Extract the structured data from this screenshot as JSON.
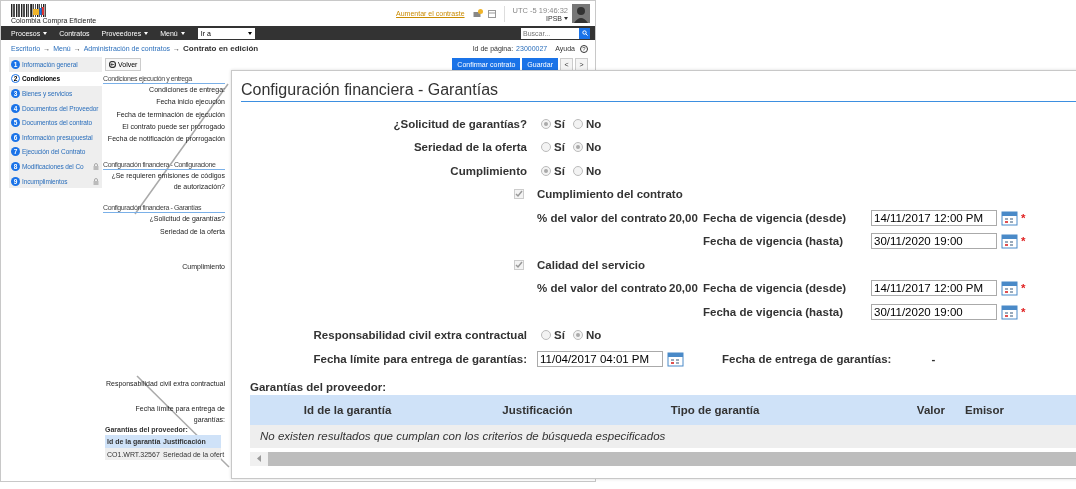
{
  "background_page": {
    "logo_text": "Colombia Compra Eficiente",
    "contrast_link": "Aumentar el contraste",
    "clock": "UTC -5 19:46:32",
    "user": "IPSB",
    "nav": [
      {
        "label": "Procesos",
        "menu": true
      },
      {
        "label": "Contratos",
        "menu": false
      },
      {
        "label": "Proveedores",
        "menu": true
      },
      {
        "label": "Menú",
        "menu": true
      }
    ],
    "goto_select": "Ir a",
    "search_placeholder": "Buscar...",
    "breadcrumb": [
      {
        "kind": "link",
        "label": "Escritorio"
      },
      {
        "kind": "separator",
        "label": "→"
      },
      {
        "kind": "link",
        "label": "Menú"
      },
      {
        "kind": "separator",
        "label": "→"
      },
      {
        "kind": "link",
        "label": "Administración de contratos"
      },
      {
        "kind": "separator",
        "label": "→"
      },
      {
        "kind": "current",
        "label": "Contrato en edición"
      }
    ],
    "page_id_label": "Id de página:",
    "page_id": "23000027",
    "help": "Ayuda",
    "help_icon": "?",
    "back_button": "Volver",
    "actions": [
      {
        "label": "Confirmar contrato",
        "kind": "primary"
      },
      {
        "label": "Guardar",
        "kind": "primary"
      },
      {
        "label": "<",
        "kind": "pager"
      },
      {
        "label": ">",
        "kind": "pager"
      }
    ],
    "steps": [
      {
        "number": "1",
        "label": "Información general",
        "selected": false,
        "locked": false
      },
      {
        "number": "2",
        "label": "Condiciones",
        "selected": true,
        "locked": false
      },
      {
        "number": "3",
        "label": "Bienes y servicios",
        "selected": false,
        "locked": false
      },
      {
        "number": "4",
        "label": "Documentos del Proveedor",
        "selected": false,
        "locked": false
      },
      {
        "number": "5",
        "label": "Documentos del contrato",
        "selected": false,
        "locked": false
      },
      {
        "number": "6",
        "label": "Información presupuestal",
        "selected": false,
        "locked": false
      },
      {
        "number": "7",
        "label": "Ejecución del Contrato",
        "selected": false,
        "locked": false
      },
      {
        "number": "8",
        "label": "Modificaciones del Co",
        "selected": false,
        "locked": true
      },
      {
        "number": "9",
        "label": "Incumplimientos",
        "selected": false,
        "locked": true
      }
    ],
    "sections": [
      {
        "title": "Condiciones ejecución y entrega",
        "rows": [
          "Condiciones de entrega:",
          "Fecha inicio ejecución",
          "Fecha de terminación de ejecución",
          "El contrato puede ser prorrogado",
          "Fecha de notificación de prorrogación"
        ]
      },
      {
        "title": "Configuración financiera - Configuracione",
        "rows": [
          "¿Se requieren emisiones de códigos de autorización?"
        ]
      },
      {
        "title": "Configuración financiera - Garantías",
        "rows": [
          "¿Solicitud de garantías?",
          "Seriedad de la oferta",
          "Cumplimiento",
          "Responsabilidad civil extra contractual",
          "Fecha límite para entrega de garantías:"
        ]
      }
    ],
    "guarantees_title": "Garantías del proveedor:",
    "guarantees_columns": [
      "Id de la garantía",
      "Justificación"
    ],
    "guarantees_rows": [
      [
        "CO1.WRT.32567",
        "Seriedad de la ofert"
      ]
    ]
  },
  "panel": {
    "title": "Configuración financiera - Garantías",
    "rows": [
      {
        "kind": "choice",
        "label": "¿Solicitud de garantías?",
        "options": [
          {
            "label": "Sí",
            "selected": true
          },
          {
            "label": "No",
            "selected": false
          }
        ]
      },
      {
        "kind": "choice",
        "label": "Seriedad de la oferta",
        "options": [
          {
            "label": "Sí",
            "selected": false
          },
          {
            "label": "No",
            "selected": true
          }
        ]
      },
      {
        "kind": "choice",
        "label": "Cumplimiento",
        "options": [
          {
            "label": "Sí",
            "selected": true
          },
          {
            "label": "No",
            "selected": false
          }
        ]
      },
      {
        "kind": "coverage",
        "label": "Cumplimiento del contrato",
        "checked": true,
        "percent_label": "% del valor del contrato",
        "percent": "20,00",
        "from_label": "Fecha de vigencia (desde)",
        "from": "14/11/2017 12:00 PM",
        "from_mark": "*",
        "to_label": "Fecha de vigencia (hasta)",
        "to": "30/11/2020 19:00",
        "to_mark": "*"
      },
      {
        "kind": "coverage",
        "label": "Calidad del servicio",
        "checked": true,
        "percent_label": "% del valor del contrato",
        "percent": "20,00",
        "from_label": "Fecha de vigencia (desde)",
        "from": "14/11/2017 12:00 PM",
        "from_mark": "*",
        "to_label": "Fecha de vigencia (hasta)",
        "to": "30/11/2020 19:00",
        "to_mark": "*"
      },
      {
        "kind": "choice",
        "label": "Responsabilidad civil extra contractual",
        "options": [
          {
            "label": "Sí",
            "selected": false
          },
          {
            "label": "No",
            "selected": true
          }
        ]
      },
      {
        "kind": "deadline",
        "label": "Fecha límite para entrega de garantías:",
        "value": "11/04/2017 04:01 PM",
        "delivery_label": "Fecha de entrega de garantías:",
        "delivery_value": "-"
      }
    ],
    "table": {
      "title": "Garantías del proveedor:",
      "columns": [
        "Id de la garantía",
        "Justificación",
        "Tipo de garantía",
        "Valor",
        "Emisor"
      ],
      "empty_message": "No existen resultados que cumplan con los criterios de búsqueda especificados"
    }
  }
}
